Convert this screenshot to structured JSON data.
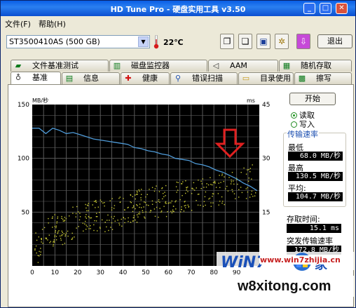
{
  "window": {
    "title": "HD Tune Pro - 硬盘实用工具 v3.50"
  },
  "menu": {
    "file": "文件(F)",
    "help": "帮助(H)"
  },
  "toolbar": {
    "drive": "ST3500410AS (500 GB)",
    "temperature": "22℃",
    "exit_label": "退出",
    "icons": [
      "copy-text-icon",
      "copy-image-icon",
      "save-icon",
      "options-icon",
      "download-icon"
    ]
  },
  "tabs": {
    "row1": [
      "文件基准测试",
      "磁盘监控器",
      "AAM",
      "随机存取"
    ],
    "row2": [
      "基准",
      "信息",
      "健康",
      "错误扫描",
      "目录使用",
      "擦写"
    ]
  },
  "controls": {
    "start_label": "开始",
    "read_label": "读取",
    "write_label": "写入",
    "mode_selected": "读取"
  },
  "stats": {
    "transfer_title": "传输速率",
    "min_label": "最低",
    "min_value": "68.0 MB/秒",
    "max_label": "最高",
    "max_value": "130.5 MB/秒",
    "avg_label": "平均:",
    "avg_value": "104.7 MB/秒",
    "access_label": "存取时间:",
    "access_value": "15.1 ms",
    "burst_label": "突发传输速率",
    "burst_value": "172.8 MB/秒"
  },
  "chart_data": {
    "type": "line",
    "ylabel_left": "MB/秒",
    "ylabel_right": "ms",
    "xlim": [
      0,
      100
    ],
    "ylim_left": [
      0,
      150
    ],
    "ylim_right": [
      0,
      45
    ],
    "x_ticks": [
      "0",
      "10",
      "20",
      "30",
      "40",
      "50",
      "60",
      "70",
      "80",
      "90"
    ],
    "y_ticks_left": [
      "50",
      "100",
      "150"
    ],
    "y_ticks_right": [
      "15",
      "30",
      "45"
    ],
    "grid": true,
    "series": [
      {
        "axis": "left",
        "color": "#4f9bd8",
        "x": [
          0,
          3,
          6,
          9,
          12,
          15,
          18,
          21,
          24,
          27,
          30,
          33,
          36,
          39,
          42,
          45,
          48,
          51,
          54,
          57,
          60,
          63,
          66,
          69,
          72,
          75,
          78,
          81,
          84,
          87,
          90,
          93,
          96,
          99
        ],
        "values": [
          128,
          128,
          123,
          128,
          126,
          123,
          124,
          122,
          120,
          118,
          117,
          116,
          115,
          114,
          113,
          110,
          109,
          107,
          106,
          104,
          103,
          100,
          99,
          98,
          95,
          94,
          92,
          89,
          87,
          84,
          81,
          77,
          74,
          70
        ]
      },
      {
        "axis": "right",
        "color": "#c8c832",
        "style": "scatter",
        "note_trend": [
          5,
          10,
          10,
          12,
          13,
          14,
          14,
          15,
          16,
          17,
          18,
          18,
          19,
          20,
          20,
          21,
          21,
          22,
          23,
          24
        ],
        "trend_x": [
          2,
          7,
          12,
          17,
          22,
          27,
          32,
          37,
          42,
          47,
          52,
          57,
          62,
          67,
          72,
          77,
          82,
          87,
          92,
          97
        ]
      }
    ]
  },
  "colors": {
    "plot_bg": "#000000",
    "grid": "#5a5a5a",
    "read_line": "#4f9bd8",
    "access_points": "#c8c832",
    "arrow": "#e02020"
  },
  "watermark": {
    "brand": "WiN7",
    "site1": "www.win7zhijia.cn",
    "site2": "w8xitong.com"
  }
}
